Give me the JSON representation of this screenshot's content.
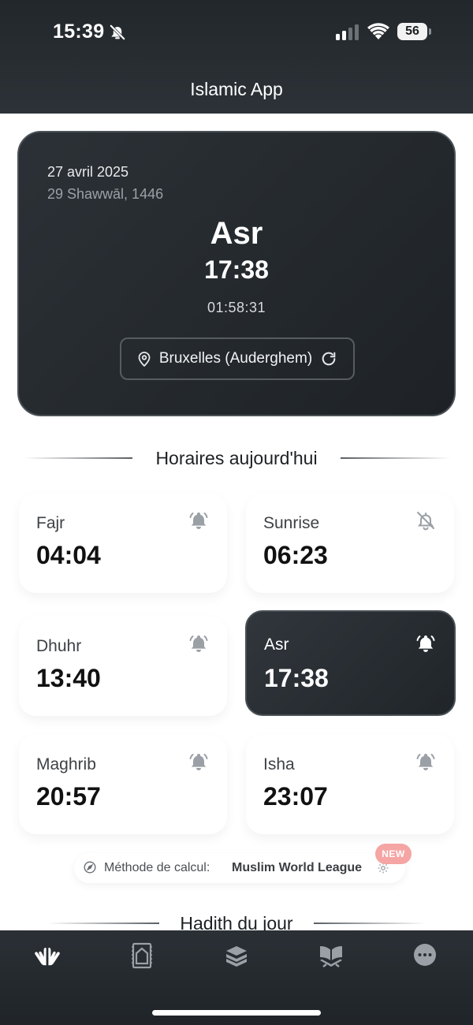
{
  "status_bar": {
    "time": "15:39",
    "battery": "56",
    "icons": [
      "bell-off-icon",
      "signal-icon",
      "wifi-icon",
      "battery-icon"
    ]
  },
  "header": {
    "title": "Islamic App"
  },
  "hero": {
    "gregorian_date": "27 avril 2025",
    "hijri_date": "29 Shawwāl, 1446",
    "next_prayer": "Asr",
    "next_prayer_time": "17:38",
    "countdown": "01:58:31",
    "location": "Bruxelles (Auderghem)"
  },
  "schedule": {
    "title": "Horaires aujourd'hui",
    "prayers": [
      {
        "name": "Fajr",
        "time": "04:04",
        "icon": "bell-icon"
      },
      {
        "name": "Sunrise",
        "time": "06:23",
        "icon": "bell-off-icon"
      },
      {
        "name": "Dhuhr",
        "time": "13:40",
        "icon": "bell-icon"
      },
      {
        "name": "Asr",
        "time": "17:38",
        "icon": "bell-icon",
        "active": true
      },
      {
        "name": "Maghrib",
        "time": "20:57",
        "icon": "bell-icon"
      },
      {
        "name": "Isha",
        "time": "23:07",
        "icon": "bell-icon"
      }
    ]
  },
  "method": {
    "label": "Méthode de calcul:",
    "value": "Muslim World League",
    "badge": "NEW"
  },
  "hadith": {
    "title": "Hadith du jour"
  },
  "bottom_nav": {
    "items": [
      "praying-hands-icon",
      "prayer-rug-icon",
      "book-stack-icon",
      "quran-stand-icon",
      "more-icon"
    ],
    "active_index": 0
  },
  "colors": {
    "dark_surface": "#22272b",
    "accent_badge": "#f5a5a3",
    "muted_icon": "#9aa0a6"
  }
}
